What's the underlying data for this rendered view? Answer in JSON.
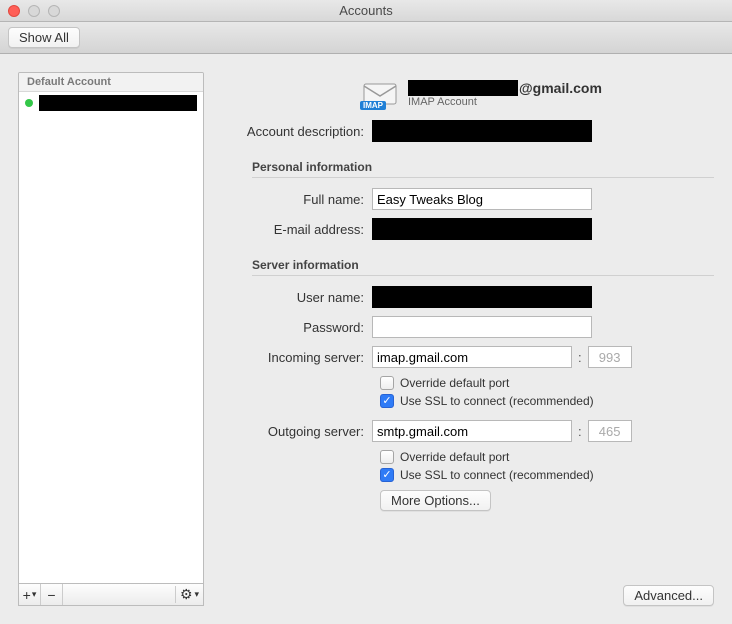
{
  "window": {
    "title": "Accounts"
  },
  "toolbar": {
    "show_all": "Show All"
  },
  "sidebar": {
    "header": "Default Account",
    "items": [
      {
        "name": ""
      }
    ],
    "footer": {
      "add": "+",
      "dropdown": "▾",
      "remove": "−",
      "gear": "⚙",
      "gear_drop": "▾"
    }
  },
  "header": {
    "email_suffix": "@gmail.com",
    "subtitle": "IMAP Account",
    "imap_badge": "IMAP"
  },
  "labels": {
    "description": "Account description:",
    "personal_section": "Personal information",
    "full_name": "Full name:",
    "email": "E-mail address:",
    "server_section": "Server information",
    "user_name": "User name:",
    "password": "Password:",
    "incoming": "Incoming server:",
    "outgoing": "Outgoing server:",
    "override_port": "Override default port",
    "use_ssl": "Use SSL to connect (recommended)",
    "more_options": "More Options...",
    "advanced": "Advanced...",
    "colon": ":"
  },
  "values": {
    "full_name": "Easy Tweaks Blog",
    "password": "",
    "incoming_server": "imap.gmail.com",
    "incoming_port": "993",
    "outgoing_server": "smtp.gmail.com",
    "outgoing_port": "465"
  },
  "checks": {
    "incoming_override": false,
    "incoming_ssl": true,
    "outgoing_override": false,
    "outgoing_ssl": true
  }
}
